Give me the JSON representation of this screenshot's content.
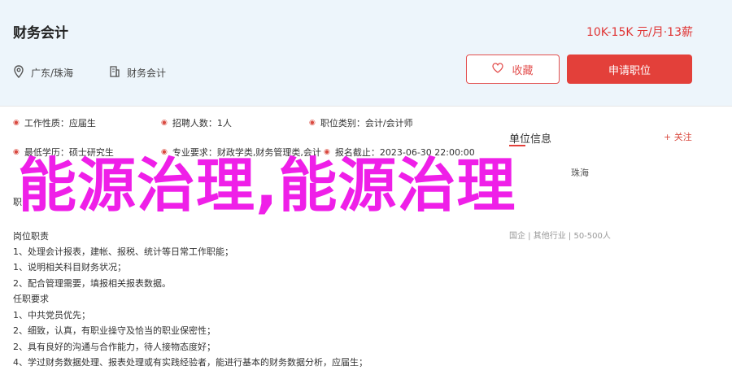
{
  "job": {
    "title": "财务会计",
    "salary": "10K-15K 元/月·13薪",
    "location": "广东/珠海",
    "category": "财务会计"
  },
  "actions": {
    "favorite_label": "收藏",
    "apply_label": "申请职位"
  },
  "info": {
    "row1": [
      {
        "label": "工作性质：",
        "value": "应届生"
      },
      {
        "label": "招聘人数：",
        "value": "1人"
      },
      {
        "label": "职位类别：",
        "value": "会计/会计师"
      }
    ],
    "row2": [
      {
        "label": "最低学历：",
        "value": "硕士研究生"
      },
      {
        "label": "专业要求：",
        "value": "财政学类,财务管理类,会计"
      },
      {
        "label": "报名截止：",
        "value": "2023-06-30 22:00:00"
      }
    ]
  },
  "company_panel": {
    "title": "单位信息",
    "follow_label": "+ 关注",
    "name_partial": "珠海",
    "sub_info": "国企 | 其他行业 | 50-500人"
  },
  "description": {
    "partial_heading": "职",
    "duties_heading": "岗位职责",
    "duties": [
      "1、处理会计报表，建帐、报税、统计等日常工作职能；",
      "1、说明相关科目财务状况；",
      "2、配合管理需要，填报相关报表数据。"
    ],
    "requirements_heading": "任职要求",
    "requirements": [
      "1、中共党员优先；",
      "2、细致，认真，有职业操守及恰当的职业保密性；",
      "2、具有良好的沟通与合作能力，待人接物态度好；",
      "4、学过财务数据处理、报表处理或有实践经验者，能进行基本的财务数据分析，应届生；"
    ]
  },
  "overlay_text": "能源治理,能源治理",
  "colors": {
    "accent_red": "#e3403a",
    "header_bg": "#edf5fb",
    "overlay_magenta": "#ef1fe8"
  }
}
